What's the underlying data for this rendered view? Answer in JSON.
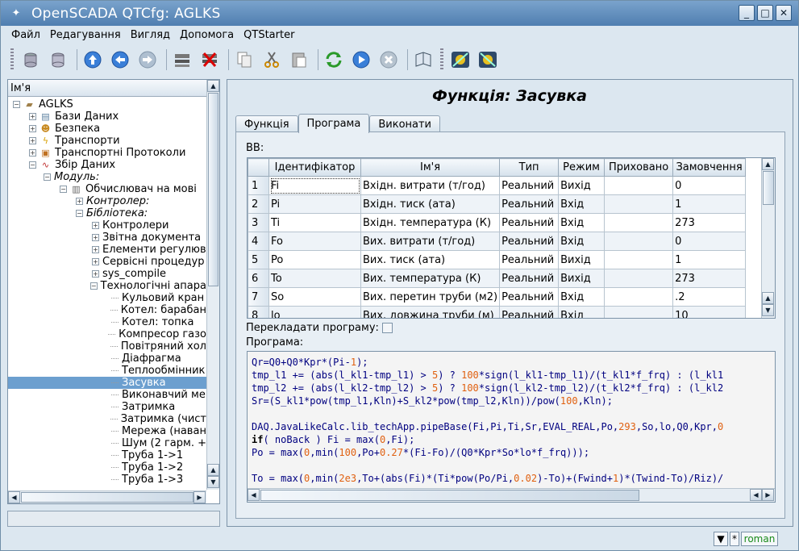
{
  "window": {
    "title": "OpenSCADA QTCfg: AGLKS",
    "buttons": [
      "_",
      "□",
      "✕"
    ]
  },
  "menu": [
    "Файл",
    "Редагування",
    "Вигляд",
    "Допомога",
    "QTStarter"
  ],
  "tree": {
    "header": "Ім'я",
    "items": [
      {
        "label": "AGLKS",
        "icon": "folder-icon",
        "exp": "−"
      },
      {
        "label": "Бази Даних",
        "icon": "database-icon",
        "exp": "+"
      },
      {
        "label": "Безпека",
        "icon": "users-icon",
        "exp": "+"
      },
      {
        "label": "Транспорти",
        "icon": "lightning-icon",
        "exp": "+"
      },
      {
        "label": "Транспортні Протоколи",
        "icon": "protocol-icon",
        "exp": "+"
      },
      {
        "label": "Збір Даних",
        "icon": "chart-icon",
        "exp": "−"
      },
      {
        "label": "Модуль:",
        "italic": true,
        "exp": "−"
      },
      {
        "label": "Обчислювач на мові",
        "icon": "module-icon",
        "exp": "−"
      },
      {
        "label": "Контролер:",
        "italic": true,
        "exp": "+"
      },
      {
        "label": "Бібліотека:",
        "italic": true,
        "exp": "−"
      },
      {
        "label": "Контролери",
        "exp": "+"
      },
      {
        "label": "Звітна документа",
        "exp": "+"
      },
      {
        "label": "Елементи регулюв",
        "exp": "+"
      },
      {
        "label": "Сервісні процедур",
        "exp": "+"
      },
      {
        "label": "sys_compile",
        "exp": "+"
      },
      {
        "label": "Технологічні апара",
        "exp": "−"
      },
      {
        "label": "Кульовий кран"
      },
      {
        "label": "Котел: барабан"
      },
      {
        "label": "Котел: топка"
      },
      {
        "label": "Компресор газо"
      },
      {
        "label": "Повітряний хол"
      },
      {
        "label": "Діафрагма"
      },
      {
        "label": "Теплообмінник"
      },
      {
        "label": "Засувка",
        "selected": true
      },
      {
        "label": "Виконавчий ме"
      },
      {
        "label": "Затримка"
      },
      {
        "label": "Затримка (чист"
      },
      {
        "label": "Мережа (наван"
      },
      {
        "label": "Шум (2 гарм. +"
      },
      {
        "label": "Труба 1->1"
      },
      {
        "label": "Труба 1->2"
      },
      {
        "label": "Труба 1->3"
      }
    ]
  },
  "main": {
    "heading": "Функція: Засувка",
    "tabs": [
      "Функція",
      "Програма",
      "Виконати"
    ],
    "io_label": "ВВ:",
    "columns": [
      "Ідентифікатор",
      "Ім'я",
      "Тип",
      "Режим",
      "Приховано",
      "Замовчення"
    ],
    "rows": [
      [
        "1",
        "Fi",
        "Вхідн. витрати (т/год)",
        "Реальний",
        "Вихід",
        "",
        "0"
      ],
      [
        "2",
        "Pi",
        "Вхідн. тиск (ата)",
        "Реальний",
        "Вхід",
        "",
        "1"
      ],
      [
        "3",
        "Ti",
        "Вхідн. температура (К)",
        "Реальний",
        "Вхід",
        "",
        "273"
      ],
      [
        "4",
        "Fo",
        "Вих. витрати (т/год)",
        "Реальний",
        "Вхід",
        "",
        "0"
      ],
      [
        "5",
        "Po",
        "Вих. тиск (ата)",
        "Реальний",
        "Вихід",
        "",
        "1"
      ],
      [
        "6",
        "To",
        "Вих. температура (К)",
        "Реальний",
        "Вихід",
        "",
        "273"
      ],
      [
        "7",
        "So",
        "Вих. перетин труби (м2)",
        "Реальний",
        "Вхід",
        "",
        ".2"
      ],
      [
        "8",
        "lo",
        "Вих. довжина труби (м)",
        "Реальний",
        "Вхід",
        "",
        "10"
      ]
    ],
    "translate_label": "Перекладати програму:",
    "program_label": "Програма:",
    "code_lines": [
      "Qr=Q0+Q0*Kpr*(Pi-1);",
      "tmp_l1 += (abs(l_kl1-tmp_l1) > 5) ? 100*sign(l_kl1-tmp_l1)/(t_kl1*f_frq) : (l_kl1",
      "tmp_l2 += (abs(l_kl2-tmp_l2) > 5) ? 100*sign(l_kl2-tmp_l2)/(t_kl2*f_frq) : (l_kl2",
      "Sr=(S_kl1*pow(tmp_l1,Kln)+S_kl2*pow(tmp_l2,Kln))/pow(100,Kln);",
      "",
      "DAQ.JavaLikeCalc.lib_techApp.pipeBase(Fi,Pi,Ti,Sr,EVAL_REAL,Po,293,So,lo,Q0,Kpr,0",
      "if( noBack ) Fi = max(0,Fi);",
      "Po = max(0,min(100,Po+0.27*(Fi-Fo)/(Q0*Kpr*So*lo*f_frq)));",
      "",
      "To = max(0,min(2e3,To+(abs(Fi)*(Ti*pow(Po/Pi,0.02)-To)+(Fwind+1)*(Twind-To)/Riz)/"
    ]
  },
  "status": {
    "star": "*",
    "user": "roman"
  }
}
